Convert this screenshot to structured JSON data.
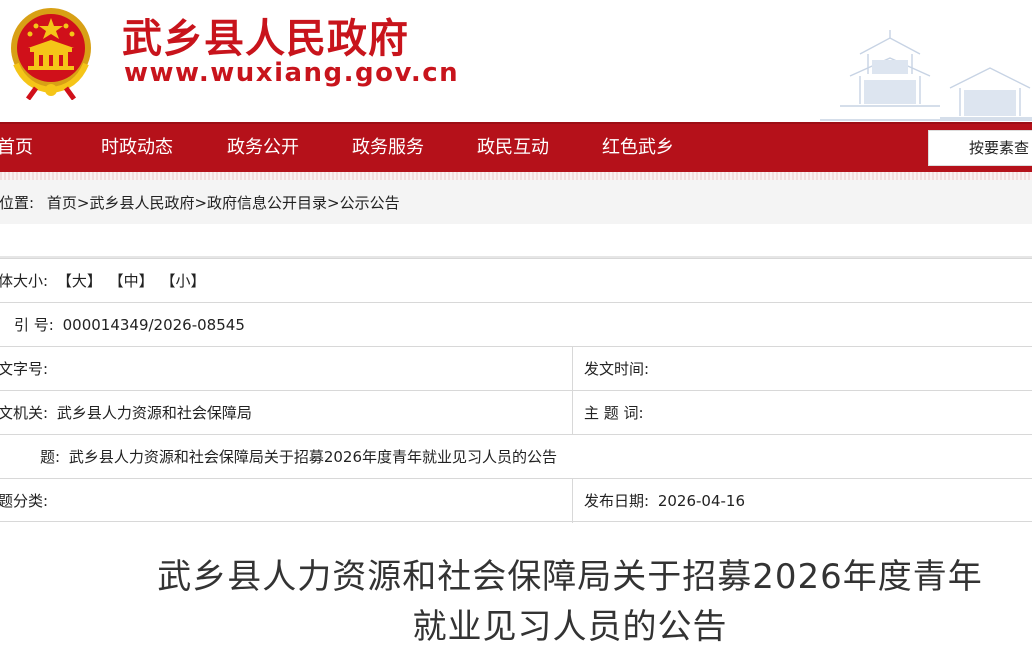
{
  "header": {
    "site_title": "武乡县人民政府",
    "site_url": "www.wuxiang.gov.cn",
    "brand_color": "#c8141c"
  },
  "nav": {
    "items": [
      {
        "label": "首页"
      },
      {
        "label": "时政动态"
      },
      {
        "label": "政务公开"
      },
      {
        "label": "政务服务"
      },
      {
        "label": "政民互动"
      },
      {
        "label": "红色武乡"
      }
    ],
    "search_placeholder": "按要素查",
    "bg_color": "#b5111a"
  },
  "breadcrumb": {
    "prefix": "位置:",
    "items": [
      "首页",
      "武乡县人民政府",
      "政府信息公开目录",
      "公示公告"
    ],
    "separator": ">"
  },
  "meta": {
    "font_size_label": "体大小:",
    "font_sizes": [
      "【大】",
      "【中】",
      "【小】"
    ],
    "index_label": "引  号:",
    "index_value": "000014349/2026-08545",
    "doc_number_label": "文字号:",
    "doc_number_value": "",
    "issue_time_label": "发文时间:",
    "issue_time_value": "",
    "issuer_label": "文机关:",
    "issuer_value": "武乡县人力资源和社会保障局",
    "keywords_label": "主  题  词:",
    "keywords_value": "",
    "title_label": "题:",
    "title_value": "武乡县人力资源和社会保障局关于招募2026年度青年就业见习人员的公告",
    "category_label": "题分类:",
    "category_value": "",
    "publish_date_label": "发布日期:",
    "publish_date_value": "2026-04-16"
  },
  "article": {
    "title_line1": "武乡县人力资源和社会保障局关于招募2026年度青年",
    "title_line2": "就业见习人员的公告"
  }
}
